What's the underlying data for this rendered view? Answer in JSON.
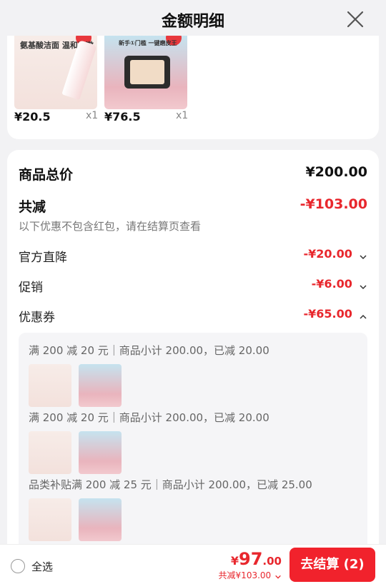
{
  "header": {
    "title": "金额明细"
  },
  "products": [
    {
      "price": "¥20.5",
      "qty": "x1",
      "thumb_text": "氨基酸洁面 温和净澈"
    },
    {
      "price": "¥76.5",
      "qty": "x1",
      "thumb_text": "新手①门槛 一键磨皮王"
    }
  ],
  "summary": {
    "total_label": "商品总价",
    "total_value": "¥200.00",
    "reduce_label": "共减",
    "reduce_value": "-¥103.00",
    "reduce_note": "以下优惠不包含红包，请在结算页查看",
    "items": [
      {
        "label": "官方直降",
        "value": "-¥20.00",
        "chevron": "chevron-down-icon"
      },
      {
        "label": "促销",
        "value": "-¥6.00",
        "chevron": "chevron-down-icon"
      },
      {
        "label": "优惠券",
        "value": "-¥65.00",
        "chevron": "chevron-up-icon"
      }
    ]
  },
  "coupons": [
    {
      "text": "满 200 减 20 元｜商品小计 200.00，已减 20.00"
    },
    {
      "text": "满 200 减 20 元｜商品小计 200.00，已减 20.00"
    },
    {
      "text": "品类补贴满 200 减 25 元｜商品小计 200.00，已减 25.00"
    }
  ],
  "footer": {
    "select_all": "全选",
    "currency": "¥",
    "amount_int": "97",
    "amount_dec": ".00",
    "saved": "共减¥103.00",
    "checkout": "去结算 (2)"
  },
  "colors": {
    "accent": "#e8272d",
    "button": "#f1222c",
    "background": "#f2f2f4"
  }
}
